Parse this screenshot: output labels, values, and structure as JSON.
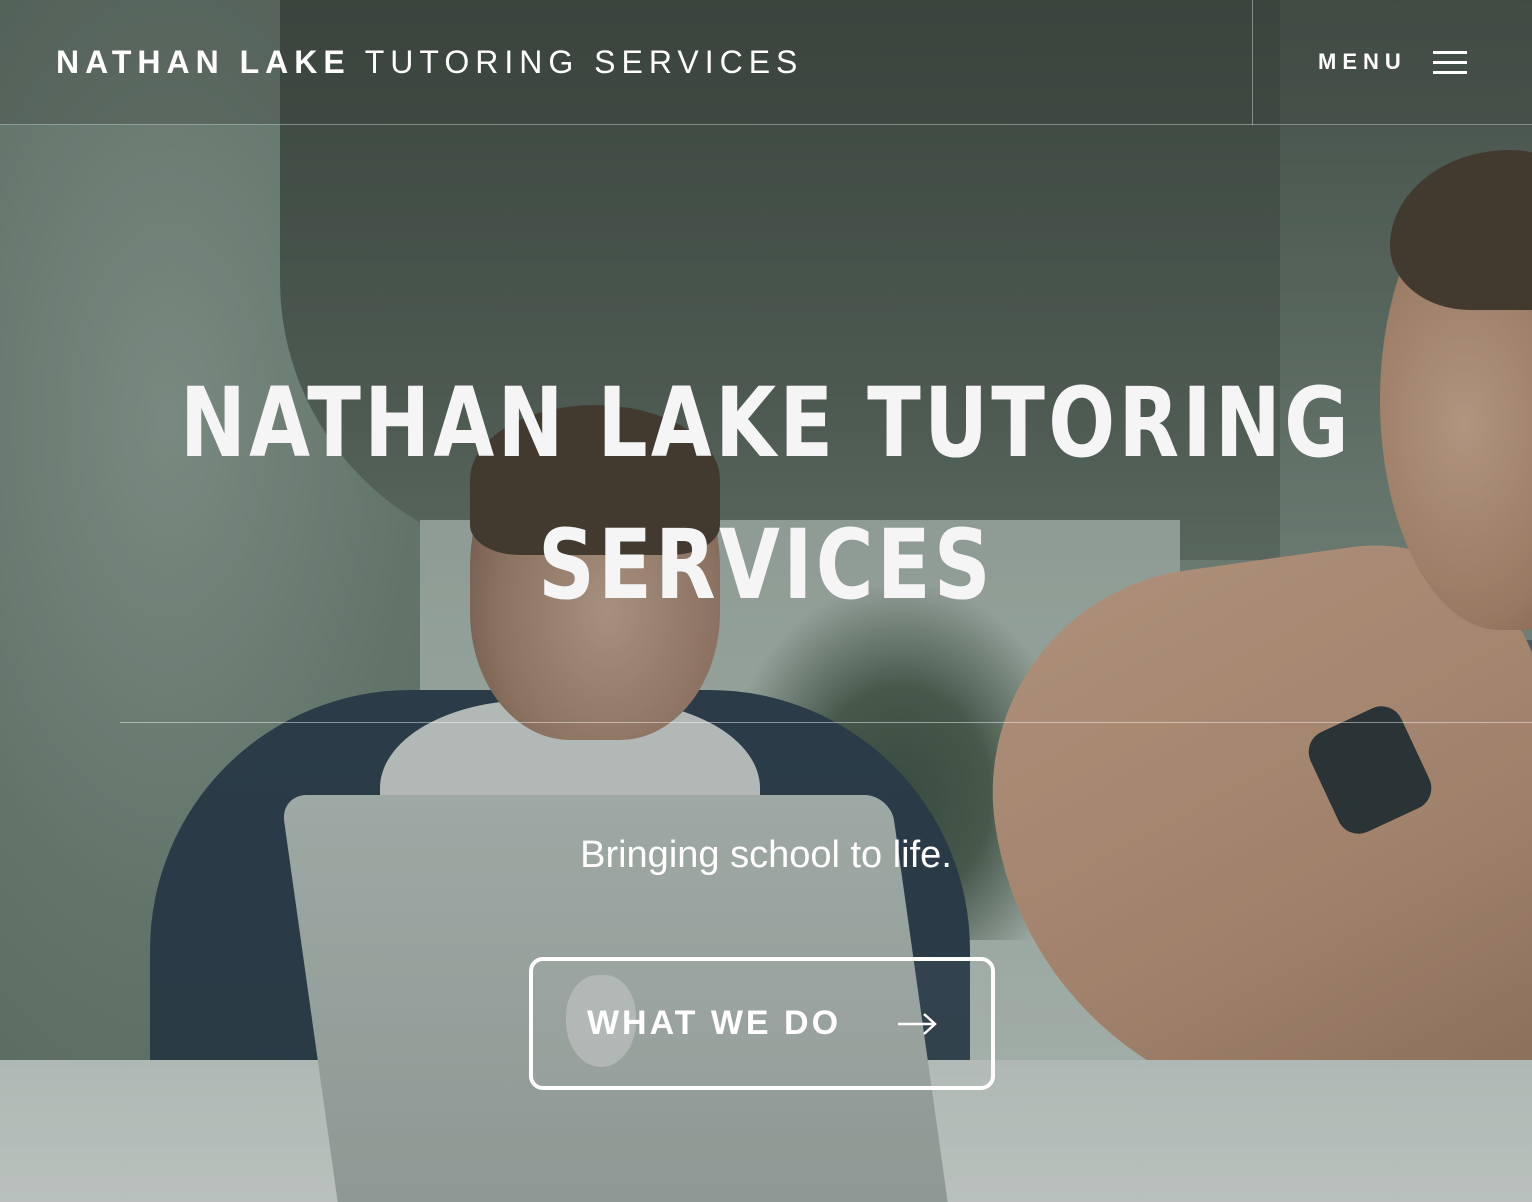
{
  "header": {
    "brand_bold": "NATHAN LAKE",
    "brand_light": "TUTORING SERVICES",
    "menu_label": "MENU"
  },
  "hero": {
    "title_line1": "NATHAN LAKE TUTORING",
    "title_line2": "SERVICES",
    "tagline": "Bringing school to life.",
    "cta_label": "WHAT WE DO"
  },
  "icons": {
    "menu": "hamburger-icon",
    "cta_arrow": "arrow-right-icon"
  },
  "colors": {
    "text": "#ffffff",
    "overlay": "#283a30"
  }
}
